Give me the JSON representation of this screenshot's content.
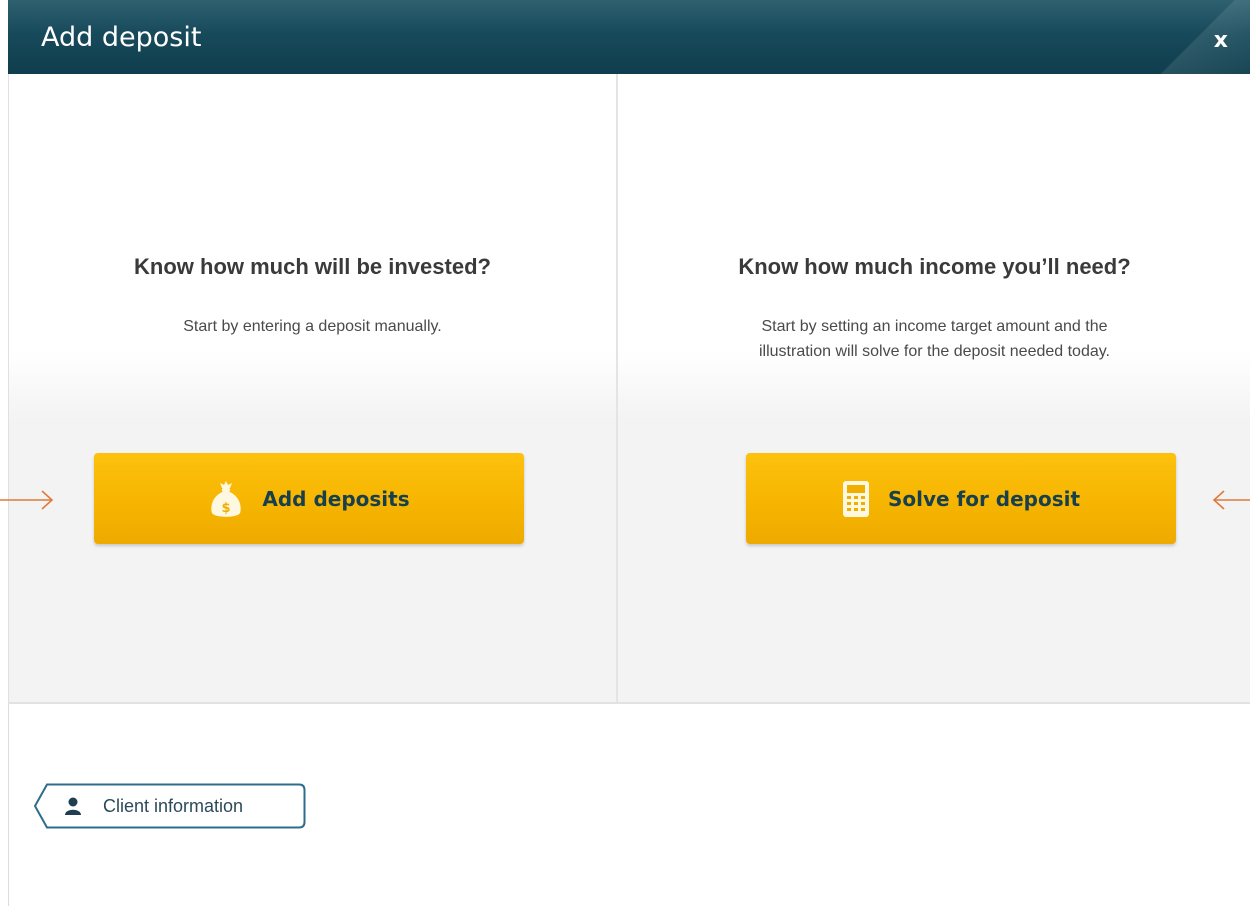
{
  "dialog": {
    "title": "Add deposit",
    "close_label": "x"
  },
  "left_panel": {
    "heading": "Know how much will be invested?",
    "description": "Start by entering a deposit manually.",
    "button_label": "Add deposits",
    "button_icon": "money-bag-icon"
  },
  "right_panel": {
    "heading": "Know how much income you’ll need?",
    "description_line1": "Start by setting an income target amount and the",
    "description_line2": "illustration will solve for the deposit needed today.",
    "button_label": "Solve for deposit",
    "button_icon": "calculator-icon"
  },
  "footer": {
    "back_button_label": "Client information",
    "back_button_icon": "person-icon"
  },
  "colors": {
    "titlebar": "#174a5b",
    "button_yellow": "#f6b500",
    "button_text": "#173f4c",
    "arrow_orange": "#e07a3a"
  }
}
